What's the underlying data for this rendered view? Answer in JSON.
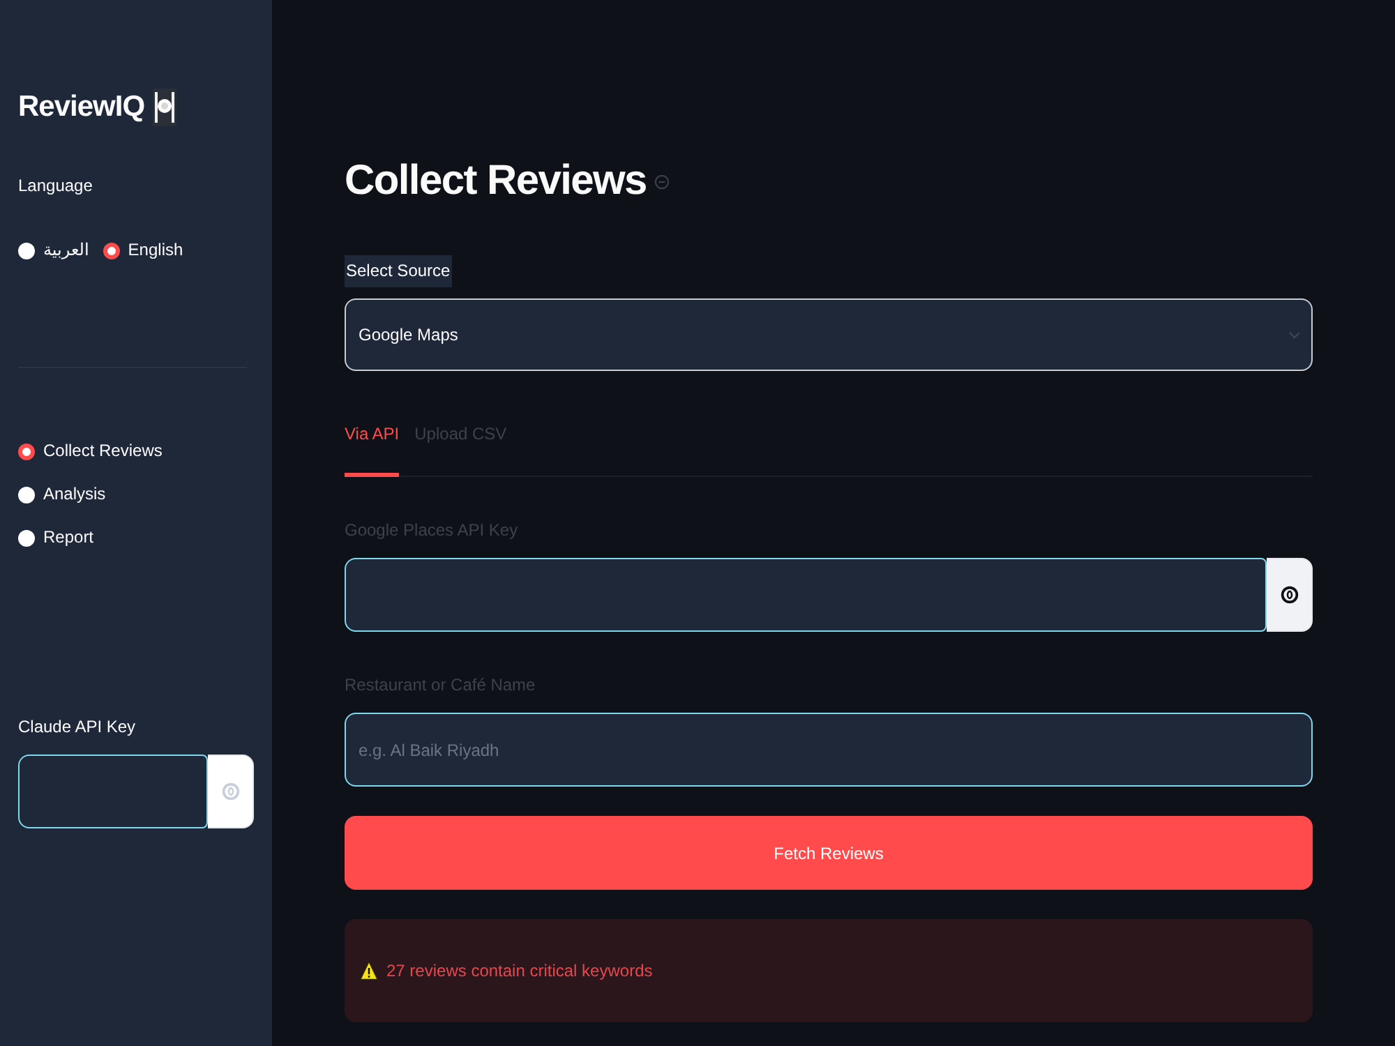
{
  "sidebar": {
    "app_title": "ReviewIQ",
    "language": {
      "label": "Language",
      "options": [
        {
          "label": "العربية",
          "selected": false
        },
        {
          "label": "English",
          "selected": true
        }
      ]
    },
    "nav": [
      {
        "label": "Collect Reviews",
        "selected": true
      },
      {
        "label": "Analysis",
        "selected": false
      },
      {
        "label": "Report",
        "selected": false
      }
    ],
    "api_key": {
      "label": "Claude API Key",
      "kind": "secret"
    }
  },
  "main": {
    "title": "Collect Reviews",
    "source": {
      "label": "Select Source",
      "value": "Google Maps"
    },
    "tabs": [
      {
        "label": "Via API",
        "selected": true
      },
      {
        "label": "Upload CSV",
        "selected": false
      }
    ],
    "fields": [
      {
        "kind": "secret",
        "label": "Google Places API Key"
      },
      {
        "kind": "text",
        "label": "Restaurant or Café Name",
        "placeholder": "e.g. Al Baik Riyadh"
      }
    ],
    "fetch_button": "Fetch Reviews",
    "alert": {
      "kind": "warning",
      "text": "27 reviews contain critical keywords"
    }
  }
}
